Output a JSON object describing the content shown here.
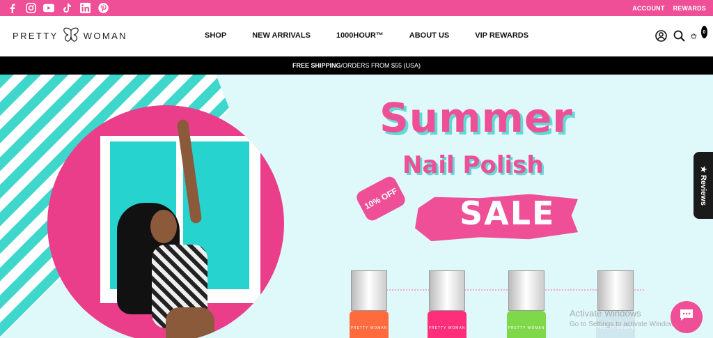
{
  "topbar": {
    "social": [
      "facebook-icon",
      "instagram-icon",
      "youtube-icon",
      "tiktok-icon",
      "linkedin-icon",
      "pinterest-icon"
    ],
    "links": [
      "ACCOUNT",
      "REWARDS"
    ]
  },
  "header": {
    "logo_left": "PRETTY",
    "logo_right": "WOMAN",
    "nav": [
      "SHOP",
      "NEW ARRIVALS",
      "1000HOUR™",
      "ABOUT US",
      "VIP REWARDS"
    ],
    "cart_count": "0"
  },
  "shipbar": {
    "bold": "FREE SHIPPING",
    "rest": "/ORDERS FROM $55 (USA)"
  },
  "hero": {
    "title": "Summer",
    "subtitle": "Nail Polish",
    "tag": "10% OFF",
    "sale": "SALE",
    "bottle_brand": "PRETTY WOMAN",
    "bottle_colors": [
      "#ff6b3d",
      "#ff2e7b",
      "#7fd84a",
      "#cfe7ee"
    ]
  },
  "widgets": {
    "reviews": "★ Reviews",
    "watermark_line1": "Activate Windows",
    "watermark_line2": "Go to Settings to activate Windows."
  },
  "colors": {
    "brand_pink": "#ee4f96",
    "teal": "#3fd7cc"
  }
}
